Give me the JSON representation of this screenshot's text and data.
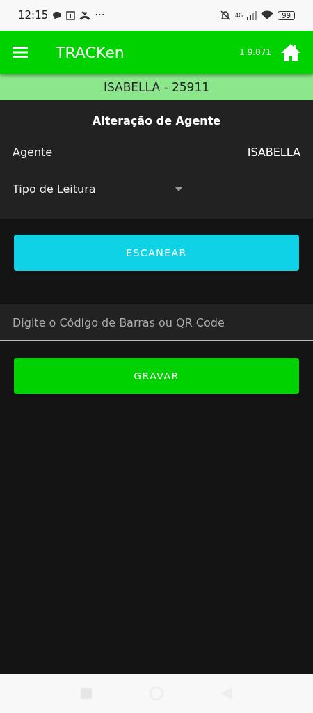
{
  "status_bar": {
    "time": "12:15",
    "more": "···",
    "network": "4G",
    "battery": "99"
  },
  "app_bar": {
    "title": "TRACKen",
    "version": "1.9.071"
  },
  "user_banner": "ISABELLA - 25911",
  "form": {
    "title": "Alteração de Agente",
    "agent_label": "Agente",
    "agent_value": "ISABELLA",
    "reading_type_label": "Tipo de Leitura"
  },
  "scan_button": "ESCANEAR",
  "code_field": {
    "placeholder": "Digite o Código de Barras ou QR Code"
  },
  "save_button": "GRAVAR"
}
